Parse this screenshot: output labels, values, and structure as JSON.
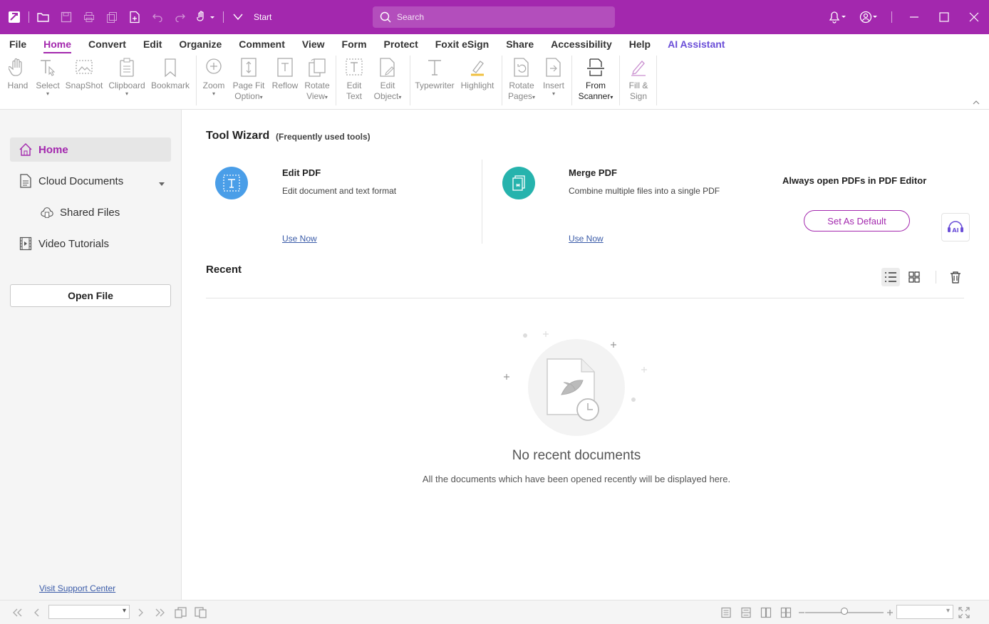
{
  "titlebar": {
    "start_label": "Start",
    "search_placeholder": "Search"
  },
  "menu": {
    "items": [
      "File",
      "Home",
      "Convert",
      "Edit",
      "Organize",
      "Comment",
      "View",
      "Form",
      "Protect",
      "Foxit eSign",
      "Share",
      "Accessibility",
      "Help",
      "AI Assistant"
    ],
    "active": "Home"
  },
  "ribbon": {
    "hand": "Hand",
    "select": "Select",
    "snapshot": "SnapShot",
    "clipboard": "Clipboard",
    "bookmark": "Bookmark",
    "zoom": "Zoom",
    "page_fit_1": "Page Fit",
    "page_fit_2": "Option",
    "reflow": "Reflow",
    "rotate_view_1": "Rotate",
    "rotate_view_2": "View",
    "edit_text_1": "Edit",
    "edit_text_2": "Text",
    "edit_object_1": "Edit",
    "edit_object_2": "Object",
    "typewriter": "Typewriter",
    "highlight": "Highlight",
    "rotate_pages_1": "Rotate",
    "rotate_pages_2": "Pages",
    "insert": "Insert",
    "from_scanner_1": "From",
    "from_scanner_2": "Scanner",
    "fill_sign_1": "Fill &",
    "fill_sign_2": "Sign"
  },
  "sidebar": {
    "home": "Home",
    "cloud_documents": "Cloud Documents",
    "shared_files": "Shared Files",
    "video_tutorials": "Video Tutorials",
    "open_file": "Open File",
    "support_link": "Visit Support Center"
  },
  "tool_wizard": {
    "title": "Tool Wizard",
    "subtitle": "(Frequently used tools)",
    "cards": [
      {
        "title": "Edit PDF",
        "desc": "Edit document and text format",
        "action": "Use Now"
      },
      {
        "title": "Merge PDF",
        "desc": "Combine multiple files into a single PDF",
        "action": "Use Now"
      }
    ],
    "default_prompt": "Always open PDFs in PDF Editor",
    "set_default": "Set As Default"
  },
  "recent": {
    "title": "Recent",
    "empty_title": "No recent documents",
    "empty_desc": "All the documents which have been opened recently will be displayed here."
  },
  "colors": {
    "brand": "#a328ae",
    "edit_icon": "#4a9ee8",
    "merge_icon": "#26b3ad",
    "link": "#3a5ba8"
  }
}
